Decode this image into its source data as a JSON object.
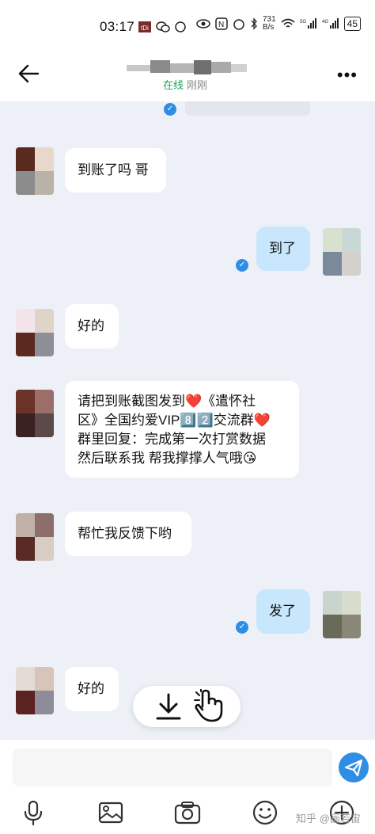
{
  "status_bar": {
    "time": "03:17",
    "net_speed_value": "731",
    "net_speed_unit": "B/s",
    "battery": "45"
  },
  "header": {
    "presence_status": "在线",
    "last_seen": "刚刚",
    "more": "•••"
  },
  "messages": [
    {
      "side": "left",
      "text": "到账了吗 哥"
    },
    {
      "side": "right",
      "text": "到了"
    },
    {
      "side": "left",
      "text": "好的"
    },
    {
      "side": "left",
      "text_lines": [
        "请把到账截图发到❤️《遣怀社",
        "区》全国约爱VIP8️⃣2️⃣交流群❤️",
        "群里回复：完成第一次打赏数据",
        "然后联系我 帮我撑撑人气哦😘"
      ]
    },
    {
      "side": "left",
      "text": "帮忙我反馈下哟"
    },
    {
      "side": "right",
      "text": "发了"
    },
    {
      "side": "left",
      "text": "好的"
    }
  ],
  "composer": {
    "value": ""
  },
  "watermark": "知乎 @画若宙",
  "colors": {
    "accent": "#2f8de4",
    "outgoing_bubble": "#c9e7fc",
    "online": "#1aa35a",
    "background": "#eef0f8"
  }
}
